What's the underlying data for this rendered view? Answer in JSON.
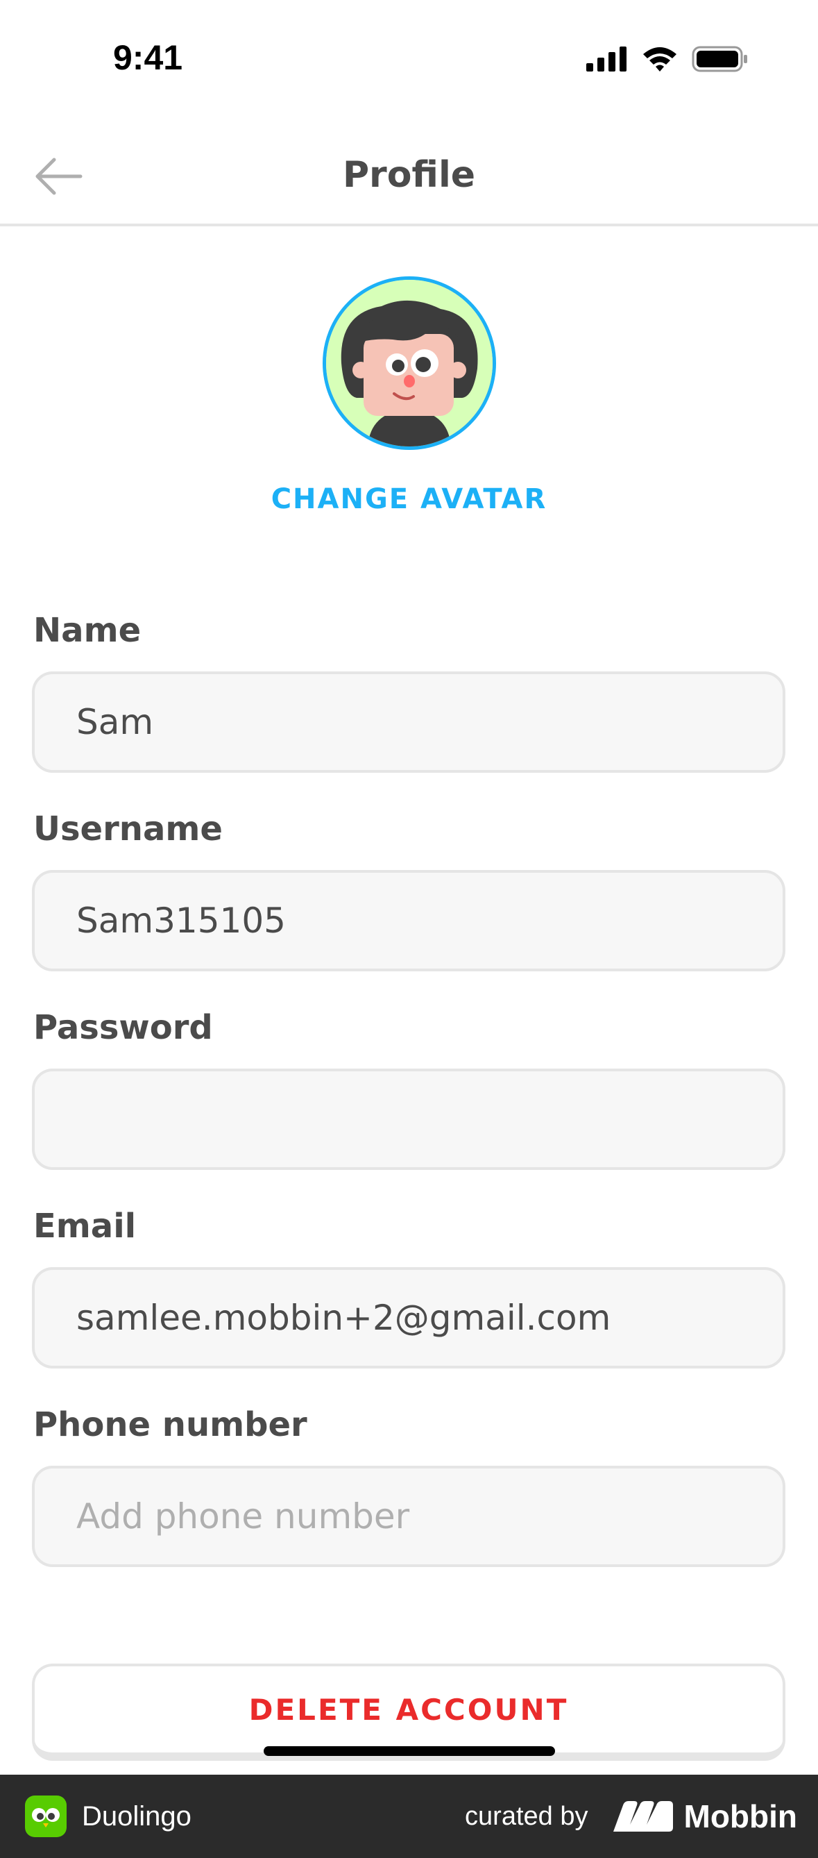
{
  "status_bar": {
    "time": "9:41"
  },
  "header": {
    "title": "Profile"
  },
  "avatar": {
    "change_label": "CHANGE AVATAR"
  },
  "form": {
    "name": {
      "label": "Name",
      "value": "Sam"
    },
    "username": {
      "label": "Username",
      "value": "Sam315105"
    },
    "password": {
      "label": "Password",
      "value": ""
    },
    "email": {
      "label": "Email",
      "value": "samlee.mobbin+2@gmail.com"
    },
    "phone": {
      "label": "Phone number",
      "value": "",
      "placeholder": "Add phone number"
    }
  },
  "actions": {
    "delete_label": "DELETE ACCOUNT"
  },
  "footer": {
    "app_name": "Duolingo",
    "curated_by": "curated by",
    "brand": "Mobbin"
  },
  "colors": {
    "accent": "#1cb0f6",
    "danger": "#ea2b2b",
    "field_bg": "#f7f7f7",
    "border": "#e5e5e5",
    "footer_bg": "#2b2b2b"
  }
}
